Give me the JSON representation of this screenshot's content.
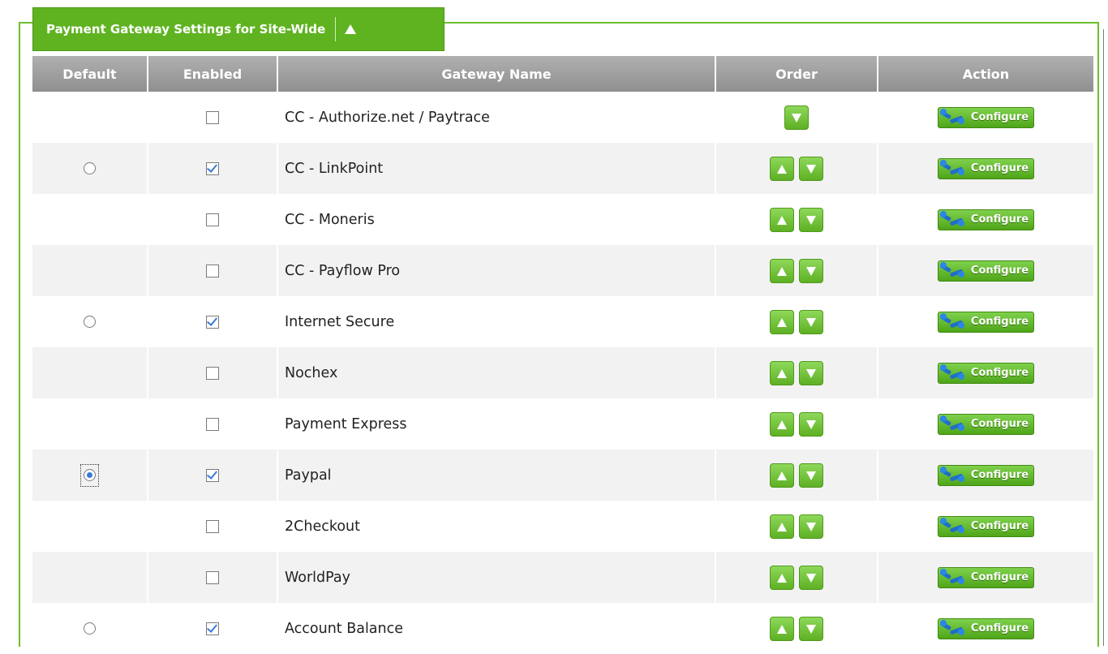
{
  "section": {
    "title": "Payment Gateway Settings for Site-Wide"
  },
  "table": {
    "headers": {
      "default": "Default",
      "enabled": "Enabled",
      "gateway_name": "Gateway Name",
      "order": "Order",
      "action": "Action"
    },
    "configure_label": "Configure",
    "rows": [
      {
        "name": "CC - Authorize.net / Paytrace",
        "default": "none",
        "enabled": false,
        "up": false,
        "down": true
      },
      {
        "name": "CC - LinkPoint",
        "default": "radio",
        "enabled": true,
        "up": true,
        "down": true
      },
      {
        "name": "CC - Moneris",
        "default": "none",
        "enabled": false,
        "up": true,
        "down": true
      },
      {
        "name": "CC - Payflow Pro",
        "default": "none",
        "enabled": false,
        "up": true,
        "down": true
      },
      {
        "name": "Internet Secure",
        "default": "radio",
        "enabled": true,
        "up": true,
        "down": true
      },
      {
        "name": "Nochex",
        "default": "none",
        "enabled": false,
        "up": true,
        "down": true
      },
      {
        "name": "Payment Express",
        "default": "none",
        "enabled": false,
        "up": true,
        "down": true
      },
      {
        "name": "Paypal",
        "default": "radio-selected",
        "enabled": true,
        "up": true,
        "down": true
      },
      {
        "name": "2Checkout",
        "default": "none",
        "enabled": false,
        "up": true,
        "down": true
      },
      {
        "name": "WorldPay",
        "default": "none",
        "enabled": false,
        "up": true,
        "down": true
      },
      {
        "name": "Account Balance",
        "default": "radio",
        "enabled": true,
        "up": true,
        "down": true
      }
    ]
  },
  "colors": {
    "accent_green": "#5fb321",
    "header_gray": "#9e9e9e",
    "check_blue": "#3a7bd5"
  }
}
